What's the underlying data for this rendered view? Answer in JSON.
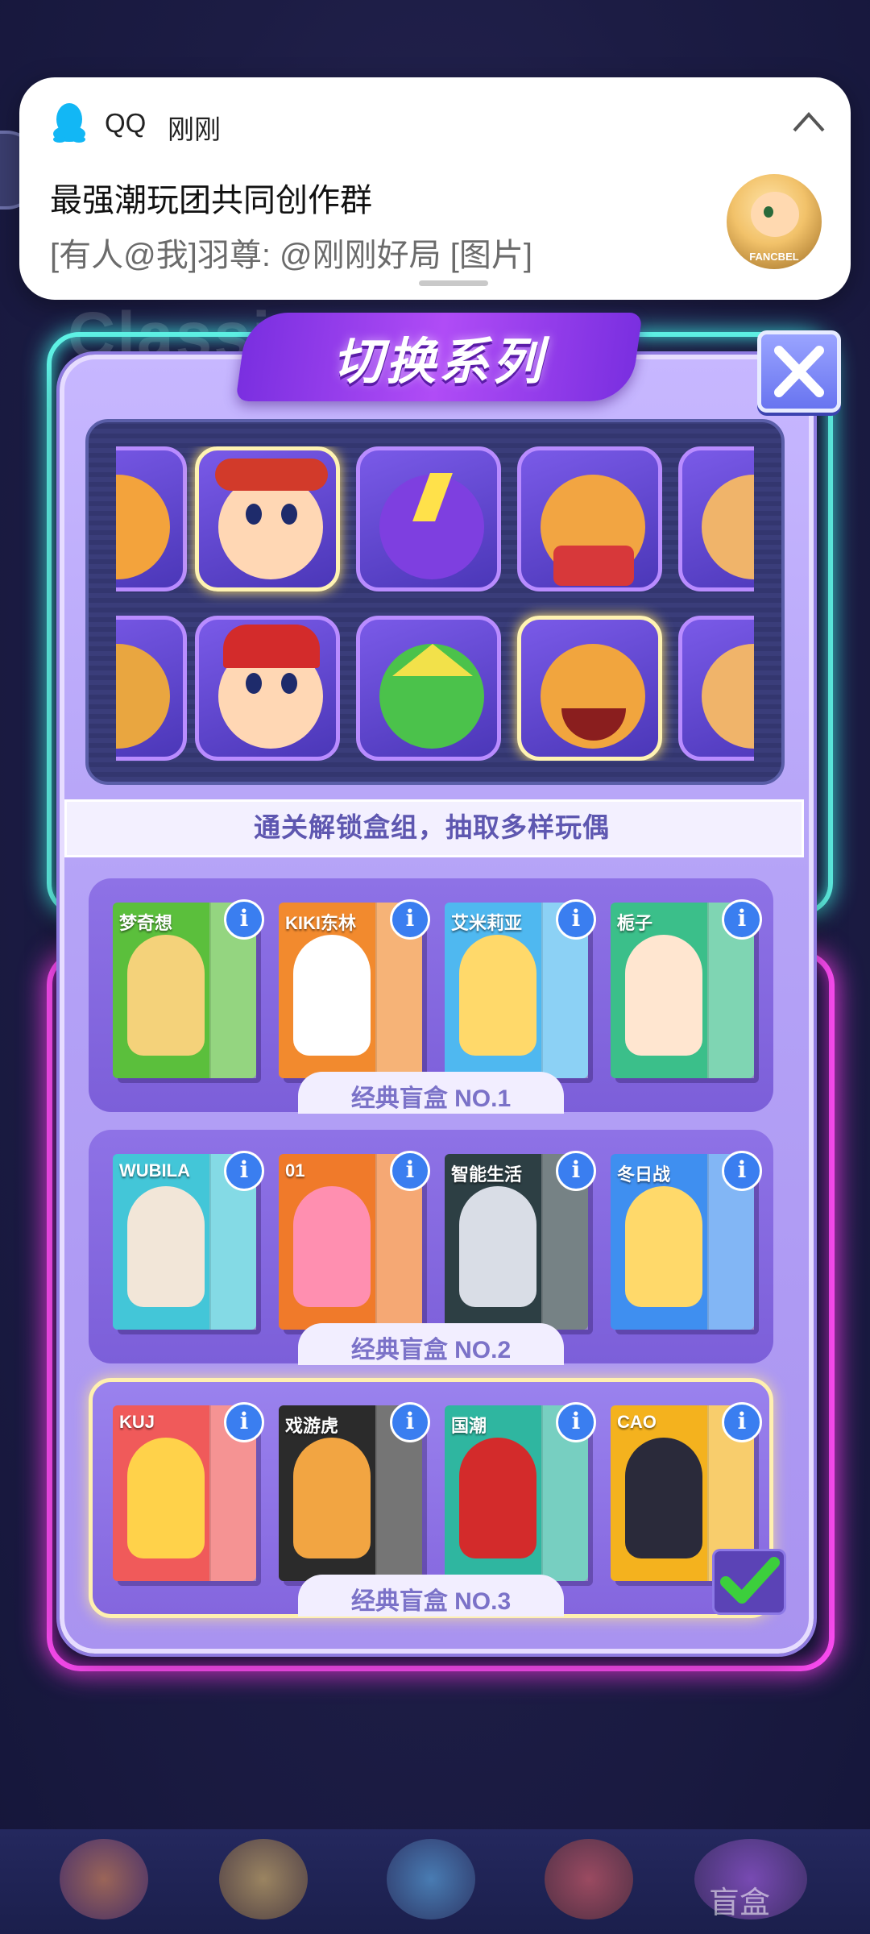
{
  "notification": {
    "app": "QQ",
    "time": "刚刚",
    "title": "最强潮玩团共同创作群",
    "message": "[有人@我]羽尊: @刚刚好局 [图片]",
    "avatar_text": "FANCBEL"
  },
  "background": {
    "ghost_title": "Classic",
    "bottom_nav_label": "盲盒"
  },
  "dialog": {
    "title": "切换系列",
    "hint": "通关解锁盒组，抽取多样玩偶",
    "rows": [
      {
        "label": "经典盲盒 NO.1",
        "boxes": [
          {
            "label": "梦奇想",
            "color": "#5bbf3c"
          },
          {
            "label": "KIKI东林",
            "color": "#f28a2e"
          },
          {
            "label": "艾米莉亚",
            "color": "#4fb8f0"
          },
          {
            "label": "栀子",
            "color": "#3bbf8a"
          }
        ],
        "selected": false
      },
      {
        "label": "经典盲盒 NO.2",
        "boxes": [
          {
            "label": "WUBILA",
            "color": "#43c6d8"
          },
          {
            "label": "01",
            "color": "#f07a2a"
          },
          {
            "label": "智能生活",
            "color": "#2d3f44"
          },
          {
            "label": "冬日战",
            "color": "#3f8ff0"
          }
        ],
        "selected": false
      },
      {
        "label": "经典盲盒 NO.3",
        "boxes": [
          {
            "label": "KUJ",
            "color": "#f05a5a"
          },
          {
            "label": "戏游虎",
            "color": "#2b2b2b"
          },
          {
            "label": "国潮",
            "color": "#2fb6a0"
          },
          {
            "label": "CAO",
            "color": "#f4b21e"
          }
        ],
        "selected": true
      }
    ]
  },
  "colors": {
    "neon_cyan": "#5ff3e6",
    "neon_magenta": "#ff4cf5",
    "dialog_purple": "#b5a3f7",
    "selected_gold": "#fff0b0",
    "check_green": "#3ccf3c"
  }
}
